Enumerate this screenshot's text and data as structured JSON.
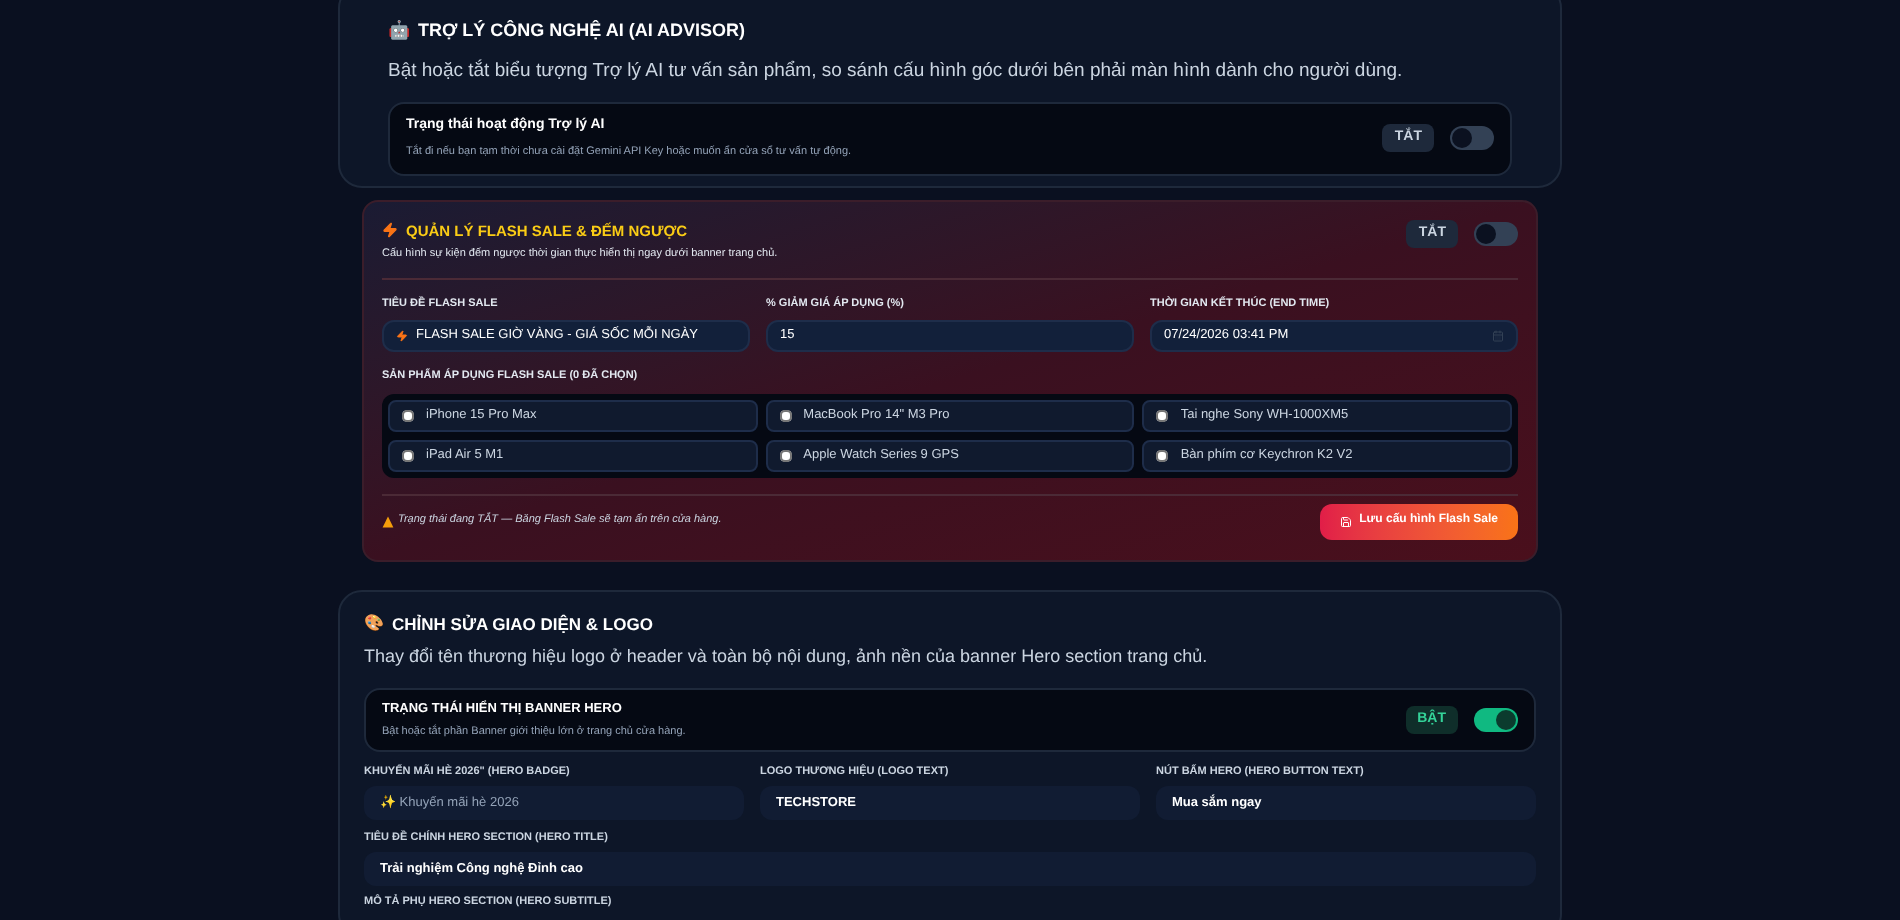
{
  "ai_advisor": {
    "icon": "🤖",
    "title": "TRỢ LÝ CÔNG NGHỆ AI (AI ADVISOR)",
    "description": "Bật hoặc tắt biểu tượng Trợ lý AI tư vấn sản phẩm, so sánh cấu hình góc dưới bên phải màn hình dành cho người dùng.",
    "status": {
      "title": "Trạng thái hoạt động Trợ lý AI",
      "description": "Tắt đi nếu bạn tạm thời chưa cài đặt Gemini API Key hoặc muốn ẩn cửa sổ tư vấn tự động.",
      "badge": "TẮT",
      "on": false
    }
  },
  "flash_sale": {
    "title": "QUẢN LÝ FLASH SALE & ĐẾM NGƯỢC",
    "description": "Cấu hình sự kiện đếm ngược thời gian thực hiển thị ngay dưới banner trang chủ.",
    "badge": "TẮT",
    "on": false,
    "fields": [
      {
        "label": "TIÊU ĐỀ FLASH SALE",
        "value": "FLASH SALE GIỜ VÀNG - GIÁ SỐC MỖI NGÀY",
        "kind": "bolt"
      },
      {
        "label": "% GIẢM GIÁ ÁP DỤNG (%)",
        "value": "15",
        "kind": "plain"
      },
      {
        "label": "THỜI GIAN KẾT THÚC (END TIME)",
        "value": "07/24/2026 03:41 PM",
        "kind": "date"
      }
    ],
    "products_label": "SẢN PHẨM ÁP DỤNG FLASH SALE (0 ĐÃ CHỌN)",
    "products": [
      {
        "name": "iPhone 15 Pro Max",
        "checked": false
      },
      {
        "name": "MacBook Pro 14\" M3 Pro",
        "checked": false
      },
      {
        "name": "Tai nghe Sony WH-1000XM5",
        "checked": false
      },
      {
        "name": "iPad Air 5 M1",
        "checked": false
      },
      {
        "name": "Apple Watch Series 9 GPS",
        "checked": false
      },
      {
        "name": "Bàn phím cơ Keychron K2 V2",
        "checked": false
      }
    ],
    "status_note": "Trạng thái đang TẮT — Băng Flash Sale sẽ tạm ẩn trên cửa hàng.",
    "save_button": "Lưu cấu hình Flash Sale"
  },
  "appearance": {
    "icon": "🎨",
    "title": "CHỈNH SỬA GIAO DIỆN & LOGO",
    "description": "Thay đổi tên thương hiệu logo ở header và toàn bộ nội dung, ảnh nền của banner Hero section trang chủ.",
    "banner_status": {
      "title": "TRẠNG THÁI HIỂN THỊ BANNER HERO",
      "description": "Bật hoặc tắt phần Banner giới thiệu lớn ở trang chủ cửa hàng.",
      "badge": "BẬT",
      "on": true
    },
    "fields": [
      {
        "label": "KHUYẾN MÃI HÈ 2026\" (HERO BADGE)",
        "value": "✨ Khuyến mãi hè 2026",
        "muted": true
      },
      {
        "label": "LOGO THƯƠNG HIỆU (LOGO TEXT)",
        "value": "TECHSTORE",
        "muted": false
      },
      {
        "label": "NÚT BẤM HERO (HERO BUTTON TEXT)",
        "value": "Mua sắm ngay",
        "muted": false
      }
    ],
    "title_field": {
      "label": "TIÊU ĐỀ CHÍNH HERO SECTION (HERO TITLE)",
      "value": "Trải nghiệm Công nghệ Đỉnh cao"
    },
    "subtitle_label": "MÔ TẢ PHỤ HERO SECTION (HERO SUBTITLE)"
  }
}
